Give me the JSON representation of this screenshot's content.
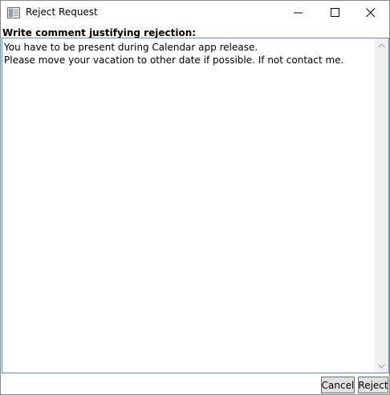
{
  "window": {
    "title": "Reject Request"
  },
  "form": {
    "prompt_label": "Write comment justifying rejection:",
    "comment_value": "You have to be present during Calendar app release.\nPlease move your vacation to other date if possible. If not contact me."
  },
  "buttons": {
    "cancel_label": "Cancel",
    "reject_label": "Reject"
  },
  "icons": {
    "app": "window-app-icon",
    "minimize": "minimize-icon",
    "maximize": "maximize-icon",
    "close": "close-icon",
    "scroll_up": "chevron-up-icon",
    "scroll_down": "chevron-down-icon"
  },
  "colors": {
    "textbox_border": "#5a8fc8",
    "button_bg": "#e1e1e1",
    "scrollbar_bg": "#f0f0f0"
  }
}
